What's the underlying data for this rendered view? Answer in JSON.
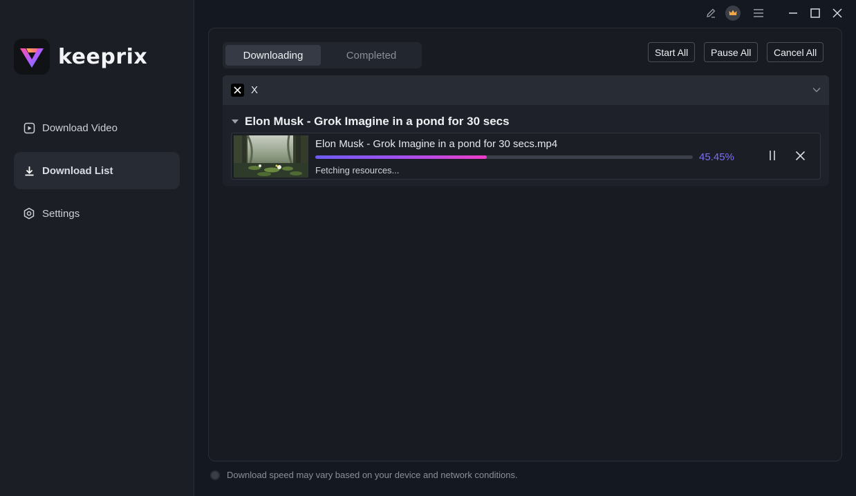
{
  "app": {
    "name": "keeprix"
  },
  "sidebar": {
    "items": [
      {
        "label": "Download Video",
        "icon": "play-square-icon",
        "active": false
      },
      {
        "label": "Download List",
        "icon": "download-icon",
        "active": true
      },
      {
        "label": "Settings",
        "icon": "gear-icon",
        "active": false
      }
    ]
  },
  "titlebar": {
    "icons": [
      "edit-icon",
      "crown-icon",
      "menu-icon",
      "minimize-icon",
      "maximize-icon",
      "close-icon"
    ]
  },
  "tabs": [
    {
      "label": "Downloading",
      "active": true
    },
    {
      "label": "Completed",
      "active": false
    }
  ],
  "actions": {
    "start_all": "Start All",
    "pause_all": "Pause All",
    "cancel_all": "Cancel All"
  },
  "group": {
    "name": "X",
    "icon": "x-logo-icon"
  },
  "download": {
    "title": "Elon Musk - Grok Imagine in a pond for 30 secs",
    "file_name": "Elon Musk - Grok Imagine in a pond for 30 secs.mp4",
    "progress_percent": 45.45,
    "progress_label": "45.45%",
    "status": "Fetching resources..."
  },
  "footer": {
    "note": "Download speed may vary based on your device and network conditions."
  },
  "colors": {
    "accent": "#7a6ef5",
    "progress_start": "#6d5cf2",
    "progress_end": "#ee3ec8",
    "background": "#141821",
    "sidebar": "#1b1e24"
  }
}
